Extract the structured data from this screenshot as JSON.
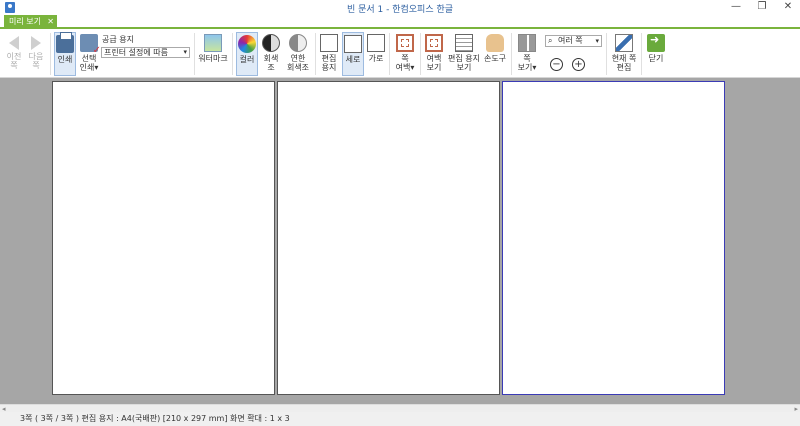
{
  "window": {
    "title": "빈 문서 1 - 한컴오피스 한글",
    "minimize": "—",
    "restore": "❐",
    "close": "✕"
  },
  "tab": {
    "label": "미리 보기",
    "close": "✕"
  },
  "ribbon": {
    "prev_page": "이전\n쪽",
    "next_page": "다음\n쪽",
    "print": "인쇄",
    "select_print": "선택\n인쇄▾",
    "paper_label": "공급 용지",
    "paper_value": "프린터 설정에 따름",
    "watermark": "워터마크",
    "color": "컬러",
    "grayscale": "회색조",
    "light_gray": "연한\n회색조",
    "edit_paper": "편집\n용지",
    "portrait": "세로",
    "landscape": "가로",
    "page_margin": "쪽\n여백▾",
    "margin_view": "여백\n보기",
    "edit_paper_view": "편집 용지\n보기",
    "hand_tool": "손도구",
    "page_view": "쪽\n보기▾",
    "zoom_value": "여러 쪽",
    "zoom_out": "−",
    "zoom_in": "+",
    "edit_current": "현재 쪽\n편집",
    "close_preview": "닫기"
  },
  "status": {
    "text": "3쪽 ( 3쪽 / 3쪽 ) 편집 용지 : A4(국배판) [210 x 297 mm] 화면 확대 : 1 x 3"
  },
  "colors": {
    "accent": "#7ab43c",
    "workspace": "#a6a6a6",
    "current_page_border": "#3b3bb5"
  }
}
